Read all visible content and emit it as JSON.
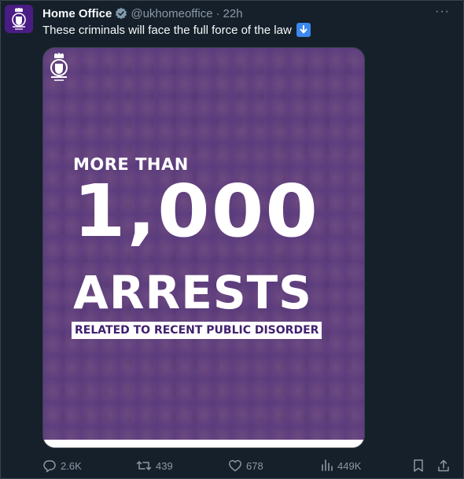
{
  "tweet": {
    "author_name": "Home Office",
    "handle": "@ukhomeoffice",
    "separator": "·",
    "time": "22h",
    "more_label": "···",
    "text": "These criminals will face the full force of the law",
    "emoji_icon": "down-arrow-emoji-icon"
  },
  "media": {
    "line1": "MORE THAN",
    "line2": "1,000",
    "line3": "ARRESTS",
    "line4": "RELATED TO RECENT PUBLIC DISORDER",
    "colors": {
      "tint": "#5c3a82",
      "label_text": "#40206f"
    }
  },
  "actions": {
    "replies": "2.6K",
    "reposts": "439",
    "likes": "678",
    "views": "449K"
  },
  "colors": {
    "background": "#15202b",
    "text": "#f7f9f9",
    "muted": "#8b98a5",
    "verified": "#829aab",
    "avatar_bg": "#4a1d84"
  }
}
